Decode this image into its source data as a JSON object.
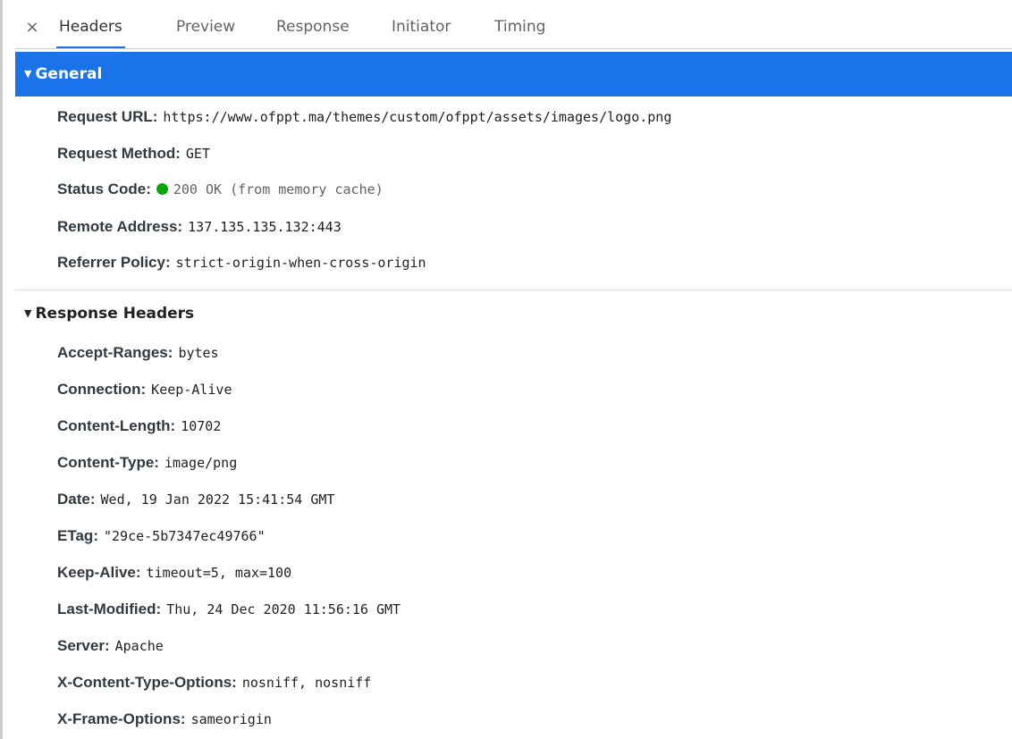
{
  "tabs": {
    "close_icon": "×",
    "items": [
      {
        "label": "Headers",
        "active": true
      },
      {
        "label": "Preview",
        "active": false
      },
      {
        "label": "Response",
        "active": false
      },
      {
        "label": "Initiator",
        "active": false
      },
      {
        "label": "Timing",
        "active": false
      }
    ]
  },
  "general": {
    "title": "General",
    "toggle_icon": "▼",
    "rows": [
      {
        "key": "Request URL",
        "value": "https://www.ofppt.ma/themes/custom/ofppt/assets/images/logo.png"
      },
      {
        "key": "Request Method",
        "value": "GET"
      },
      {
        "key": "Status Code",
        "value": "200 OK (from memory cache)",
        "status_color": "#0ca40c"
      },
      {
        "key": "Remote Address",
        "value": "137.135.135.132:443"
      },
      {
        "key": "Referrer Policy",
        "value": "strict-origin-when-cross-origin"
      }
    ]
  },
  "response_headers": {
    "title": "Response Headers",
    "toggle_icon": "▼",
    "rows": [
      {
        "key": "Accept-Ranges",
        "value": "bytes"
      },
      {
        "key": "Connection",
        "value": "Keep-Alive"
      },
      {
        "key": "Content-Length",
        "value": "10702"
      },
      {
        "key": "Content-Type",
        "value": "image/png"
      },
      {
        "key": "Date",
        "value": "Wed, 19 Jan 2022 15:41:54 GMT"
      },
      {
        "key": "ETag",
        "value": "\"29ce-5b7347ec49766\""
      },
      {
        "key": "Keep-Alive",
        "value": "timeout=5, max=100"
      },
      {
        "key": "Last-Modified",
        "value": "Thu, 24 Dec 2020 11:56:16 GMT"
      },
      {
        "key": "Server",
        "value": "Apache"
      },
      {
        "key": "X-Content-Type-Options",
        "value": "nosniff, nosniff"
      },
      {
        "key": "X-Frame-Options",
        "value": "sameorigin"
      }
    ]
  },
  "colors": {
    "accent": "#1a73e8",
    "status_ok": "#0ca40c"
  }
}
